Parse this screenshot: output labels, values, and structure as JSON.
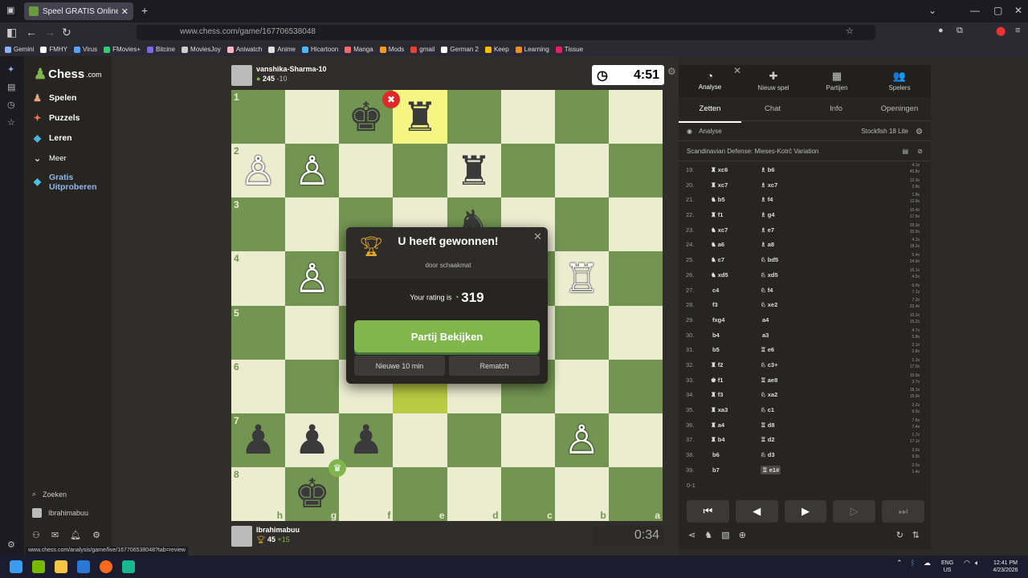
{
  "browser": {
    "tab_title": "Speel GRATIS Online Schaken -",
    "url": "www.chess.com/game/167706538048",
    "bookmarks": [
      {
        "label": "Gemini",
        "color": "#8ab4f8"
      },
      {
        "label": "FMHY",
        "color": "#ffffff"
      },
      {
        "label": "Virus",
        "color": "#5aa0ff"
      },
      {
        "label": "FMovies+",
        "color": "#2ecc71"
      },
      {
        "label": "Bitcine",
        "color": "#7b68ee"
      },
      {
        "label": "MoviesJoy",
        "color": "#cccccc"
      },
      {
        "label": "Aniwatch",
        "color": "#ffb6c1"
      },
      {
        "label": "Anime",
        "color": "#e0e0e0"
      },
      {
        "label": "Hicartoon",
        "color": "#4db6ff"
      },
      {
        "label": "Manga",
        "color": "#ff6b6b"
      },
      {
        "label": "Mods",
        "color": "#f39c12"
      },
      {
        "label": "gmail",
        "color": "#ea4335"
      },
      {
        "label": "German 2",
        "color": "#ffffff"
      },
      {
        "label": "Keep",
        "color": "#fbbc04"
      },
      {
        "label": "Learning",
        "color": "#f28c28"
      },
      {
        "label": "Tissue",
        "color": "#e91e63"
      }
    ],
    "status_url": "www.chess.com/analysis/game/live/167706538048?tab=review"
  },
  "sidebar": {
    "logo": "Chess",
    "logo_suffix": ".com",
    "items": [
      {
        "label": "Spelen",
        "icon": "♟"
      },
      {
        "label": "Puzzels",
        "icon": "✦"
      },
      {
        "label": "Leren",
        "icon": "◆"
      },
      {
        "label": "Meer",
        "icon": "⌄"
      }
    ],
    "gratis_1": "Gratis",
    "gratis_2": "Uitproberen",
    "search": "Zoeken",
    "user": "Ibrahimabuu"
  },
  "top_player": {
    "name": "vanshika-Sharma-10",
    "rating": "245",
    "delta": "-10",
    "clock": "4:51"
  },
  "bottom_player": {
    "name": "Ibrahimabuu",
    "rating": "45",
    "delta": "+15",
    "clock": "0:34"
  },
  "board": {
    "ranks": [
      "1",
      "2",
      "3",
      "4",
      "5",
      "6",
      "7",
      "8"
    ],
    "files": [
      "h",
      "g",
      "f",
      "e",
      "d",
      "c",
      "b",
      "a"
    ],
    "highlight": [
      "e1",
      "e6"
    ],
    "pieces": {
      "f1": "♚",
      "e1": "♜",
      "d2": "♜",
      "d3": "♞",
      "h2": "♙",
      "g2": "♙",
      "g4": "♙",
      "b4": "♖",
      "h7": "♟",
      "g7": "♟",
      "f7": "♟",
      "b7": "♙",
      "g8": "♚"
    }
  },
  "modal": {
    "title": "U heeft gewonnen!",
    "subtitle": "door schaakmat",
    "rating_label": "Your rating is",
    "rating_value": "319",
    "primary_button": "Partij Bekijken",
    "new_game": "Nieuwe 10 min",
    "rematch": "Rematch"
  },
  "panel": {
    "tabs": [
      {
        "label": "Analyse",
        "icon": "◔"
      },
      {
        "label": "Nieuw spel",
        "icon": "✚"
      },
      {
        "label": "Partijen",
        "icon": "▦"
      },
      {
        "label": "Spelers",
        "icon": "👥"
      }
    ],
    "subtabs": [
      "Zetten",
      "Chat",
      "Info",
      "Openingen"
    ],
    "analysis_label": "Analyse",
    "engine": "Stockfish 18 Lite",
    "opening": "Scandinavian Defense: Mieses-Kotrč Variation",
    "moves": [
      {
        "n": "19.",
        "w": "xc6",
        "wi": "♜",
        "b": "b6",
        "bi": "♗",
        "t1": "4.1s",
        "t2": "45.8s"
      },
      {
        "n": "20.",
        "w": "xc7",
        "wi": "♜",
        "b": "xc7",
        "bi": "♗",
        "t1": "12.3s",
        "t2": "2.8s"
      },
      {
        "n": "21.",
        "w": "b5",
        "wi": "♞",
        "b": "f4",
        "bi": "♗",
        "t1": "1.8s",
        "t2": "13.9s"
      },
      {
        "n": "22.",
        "w": "f1",
        "wi": "♜",
        "b": "g4",
        "bi": "♗",
        "t1": "10.4s",
        "t2": "17.5s"
      },
      {
        "n": "23.",
        "w": "xc7",
        "wi": "♞",
        "b": "e7",
        "bi": "♗",
        "t1": "29.3s",
        "t2": "10.9s"
      },
      {
        "n": "24.",
        "w": "a6",
        "wi": "♞",
        "b": "a8",
        "bi": "♗",
        "t1": "4.1s",
        "t2": "18.2s"
      },
      {
        "n": "25.",
        "w": "c7",
        "wi": "♞",
        "b": "bd5",
        "bi": "♘",
        "t1": "5.4s",
        "t2": "24.9s"
      },
      {
        "n": "26.",
        "w": "xd5",
        "wi": "♞",
        "b": "xd5",
        "bi": "♘",
        "t1": "10.1s",
        "t2": "4.5s"
      },
      {
        "n": "27.",
        "w": "c4",
        "wi": "",
        "b": "f4",
        "bi": "♘",
        "t1": "6.0s",
        "t2": "7.1s"
      },
      {
        "n": "28.",
        "w": "f3",
        "wi": "",
        "b": "xe2",
        "bi": "♘",
        "t1": "7.2s",
        "t2": "22.4s"
      },
      {
        "n": "29.",
        "w": "fxg4",
        "wi": "",
        "b": "a4",
        "bi": "",
        "t1": "10.2s",
        "t2": "15.2s"
      },
      {
        "n": "30.",
        "w": "b4",
        "wi": "",
        "b": "a3",
        "bi": "",
        "t1": "4.7s",
        "t2": "5.8s"
      },
      {
        "n": "31.",
        "w": "b5",
        "wi": "",
        "b": "e6",
        "bi": "♖",
        "t1": "2.1s",
        "t2": "2.8s"
      },
      {
        "n": "32.",
        "w": "f2",
        "wi": "♜",
        "b": "c3+",
        "bi": "♘",
        "t1": "1.2s",
        "t2": "17.0s"
      },
      {
        "n": "33.",
        "w": "f1",
        "wi": "♚",
        "b": "ae8",
        "bi": "♖",
        "t1": "10.9s",
        "t2": "3.7s"
      },
      {
        "n": "34.",
        "w": "f3",
        "wi": "♜",
        "b": "xa2",
        "bi": "♘",
        "t1": "18.1s",
        "t2": "15.9s"
      },
      {
        "n": "35.",
        "w": "xa3",
        "wi": "♜",
        "b": "c1",
        "bi": "♘",
        "t1": "2.2s",
        "t2": "9.5s"
      },
      {
        "n": "36.",
        "w": "a4",
        "wi": "♜",
        "b": "d8",
        "bi": "♖",
        "t1": "7.6s",
        "t2": "7.4s"
      },
      {
        "n": "37.",
        "w": "b4",
        "wi": "♜",
        "b": "d2",
        "bi": "♖",
        "t1": "1.7s",
        "t2": "17.1s"
      },
      {
        "n": "38.",
        "w": "b6",
        "wi": "",
        "b": "d3",
        "bi": "♘",
        "t1": "2.0s",
        "t2": "9.9s"
      },
      {
        "n": "39.",
        "w": "b7",
        "wi": "",
        "b": "e1#",
        "bi": "♖",
        "t1": "2.5s",
        "t2": "1.4s"
      }
    ],
    "result": "0-1"
  },
  "taskbar": {
    "lang1": "ENG",
    "lang2": "US",
    "time": "12:41 PM",
    "date": "4/23/2026"
  },
  "colors": {
    "board_light": "#ebecd0",
    "board_dark": "#739552",
    "accent_green": "#81b64c"
  }
}
